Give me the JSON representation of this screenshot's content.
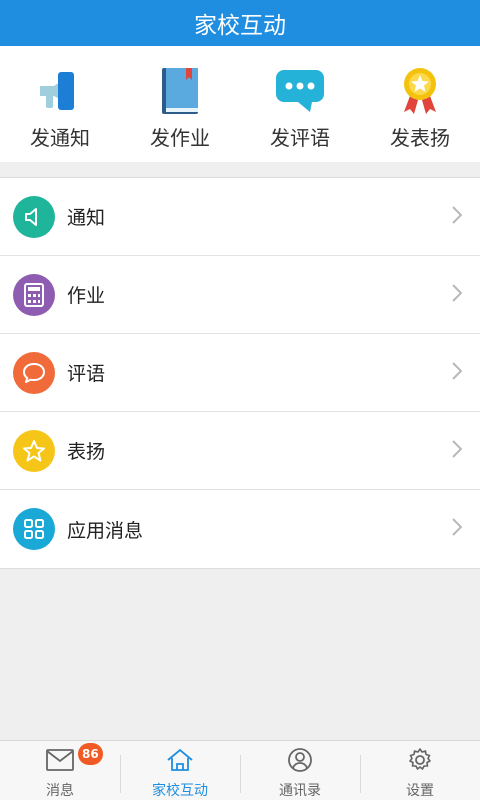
{
  "header": {
    "title": "家校互动"
  },
  "quick_actions": [
    {
      "label": "发通知",
      "icon": "megaphone-icon"
    },
    {
      "label": "发作业",
      "icon": "book-icon"
    },
    {
      "label": "发评语",
      "icon": "chat-bubble-icon"
    },
    {
      "label": "发表扬",
      "icon": "medal-icon"
    }
  ],
  "menu": [
    {
      "label": "通知",
      "icon": "speaker-icon",
      "color": "#1fb59a"
    },
    {
      "label": "作业",
      "icon": "calculator-icon",
      "color": "#8e5db1"
    },
    {
      "label": "评语",
      "icon": "speech-bubble-icon",
      "color": "#f06a3a"
    },
    {
      "label": "表扬",
      "icon": "star-icon",
      "color": "#f5c518"
    },
    {
      "label": "应用消息",
      "icon": "grid-icon",
      "color": "#1aa9d6"
    }
  ],
  "tabbar": {
    "tabs": [
      {
        "label": "消息",
        "icon": "envelope-icon",
        "badge": "86"
      },
      {
        "label": "家校互动",
        "icon": "home-icon"
      },
      {
        "label": "通讯录",
        "icon": "contact-icon"
      },
      {
        "label": "设置",
        "icon": "gear-icon"
      }
    ],
    "active_index": 1
  },
  "colors": {
    "brand": "#1f8ee0",
    "badge": "#f15a24"
  }
}
